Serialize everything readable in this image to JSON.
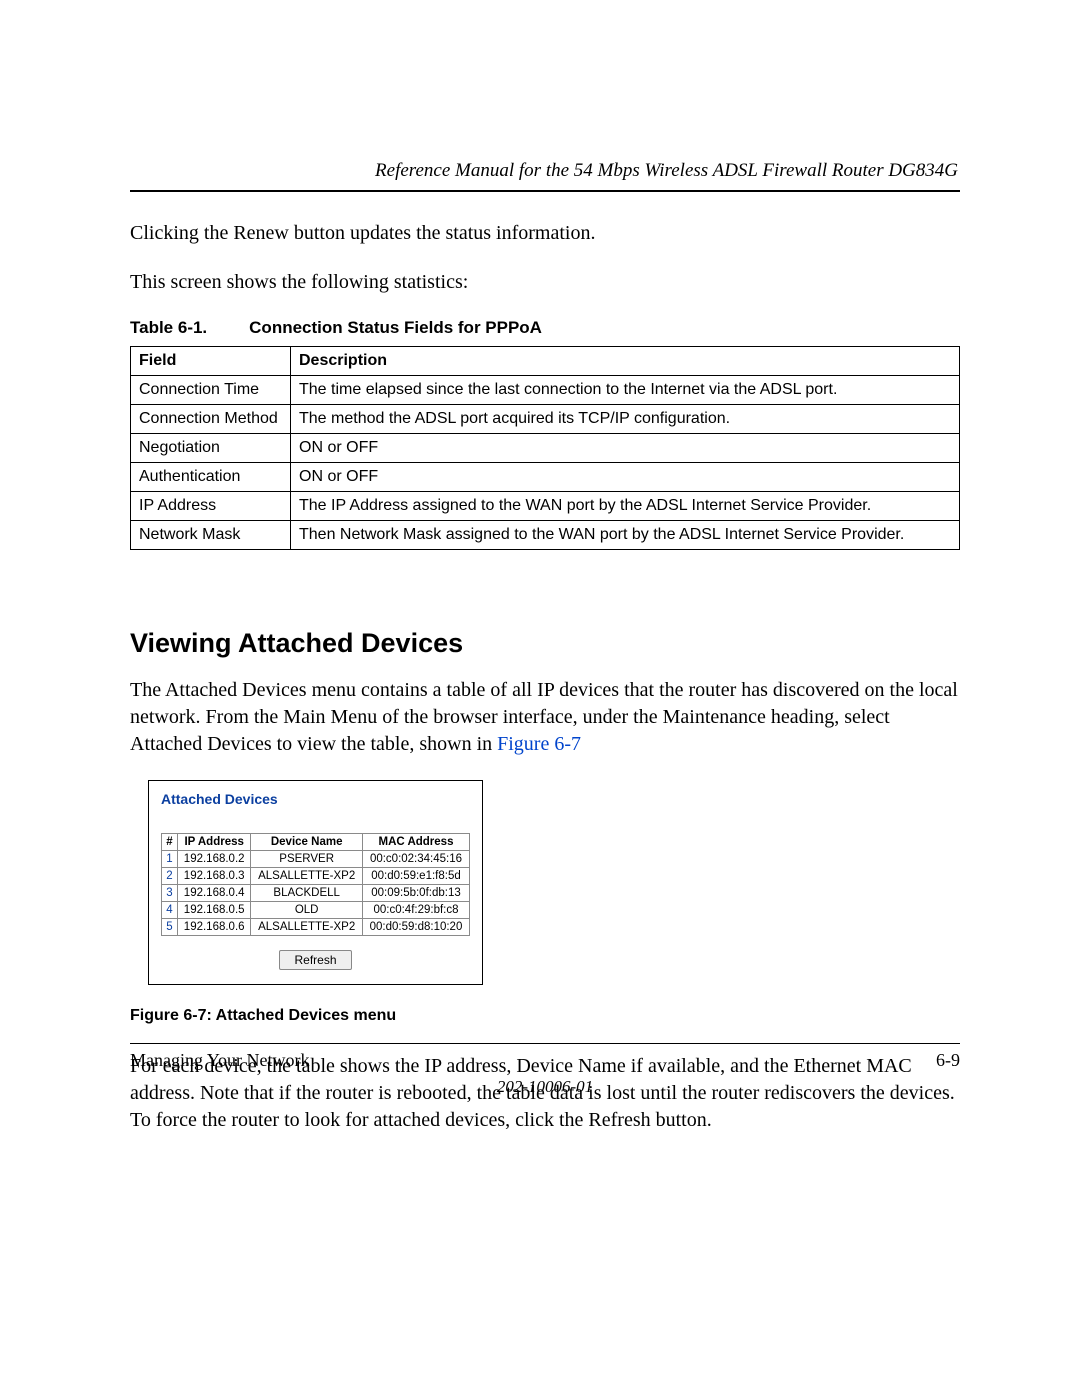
{
  "header": {
    "title": "Reference Manual for the 54 Mbps Wireless ADSL Firewall Router DG834G"
  },
  "intro": {
    "p1": "Clicking the Renew button updates the status information.",
    "p2": "This screen shows the following statistics:"
  },
  "status_table": {
    "caption_label": "Table 6-1.",
    "caption_title": "Connection Status Fields for PPPoA",
    "head_field": "Field",
    "head_desc": "Description",
    "rows": [
      {
        "field": "Connection Time",
        "desc": "The time elapsed since the last connection to the Internet via the ADSL port."
      },
      {
        "field": "Connection Method",
        "desc": "The method the ADSL port acquired its TCP/IP configuration."
      },
      {
        "field": "Negotiation",
        "desc": "ON or OFF"
      },
      {
        "field": "Authentication",
        "desc": "ON or OFF"
      },
      {
        "field": "IP Address",
        "desc": "The IP Address assigned to the WAN port by the ADSL Internet Service Provider."
      },
      {
        "field": "Network Mask",
        "desc": "Then Network Mask assigned to the WAN port by the ADSL Internet Service Provider."
      }
    ]
  },
  "section": {
    "heading": "Viewing Attached Devices",
    "p1a": "The Attached Devices menu contains a table of all IP devices that the router has discovered on the local network. From the Main Menu of the browser interface, under the Maintenance heading, select Attached Devices to view the table, shown in ",
    "p1_link": "Figure 6-7",
    "p2": "For each device, the table shows the IP address, Device Name if available, and the Ethernet MAC address. Note that if the router is rebooted, the table data is lost until the router rediscovers the devices. To force the router to look for attached devices, click the Refresh button."
  },
  "screenshot": {
    "title": "Attached Devices",
    "head_num": "#",
    "head_ip": "IP Address",
    "head_name": "Device Name",
    "head_mac": "MAC Address",
    "rows": [
      {
        "n": "1",
        "ip": "192.168.0.2",
        "name": "PSERVER",
        "mac": "00:c0:02:34:45:16"
      },
      {
        "n": "2",
        "ip": "192.168.0.3",
        "name": "ALSALLETTE-XP2",
        "mac": "00:d0:59:e1:f8:5d"
      },
      {
        "n": "3",
        "ip": "192.168.0.4",
        "name": "BLACKDELL",
        "mac": "00:09:5b:0f:db:13"
      },
      {
        "n": "4",
        "ip": "192.168.0.5",
        "name": "OLD",
        "mac": "00:c0:4f:29:bf:c8"
      },
      {
        "n": "5",
        "ip": "192.168.0.6",
        "name": "ALSALLETTE-XP2",
        "mac": "00:d0:59:d8:10:20"
      }
    ],
    "refresh_label": "Refresh"
  },
  "figure_caption": "Figure 6-7:  Attached Devices menu",
  "footer": {
    "left": "Managing Your Network",
    "right": "6-9",
    "docnum": "202-10006-01"
  }
}
